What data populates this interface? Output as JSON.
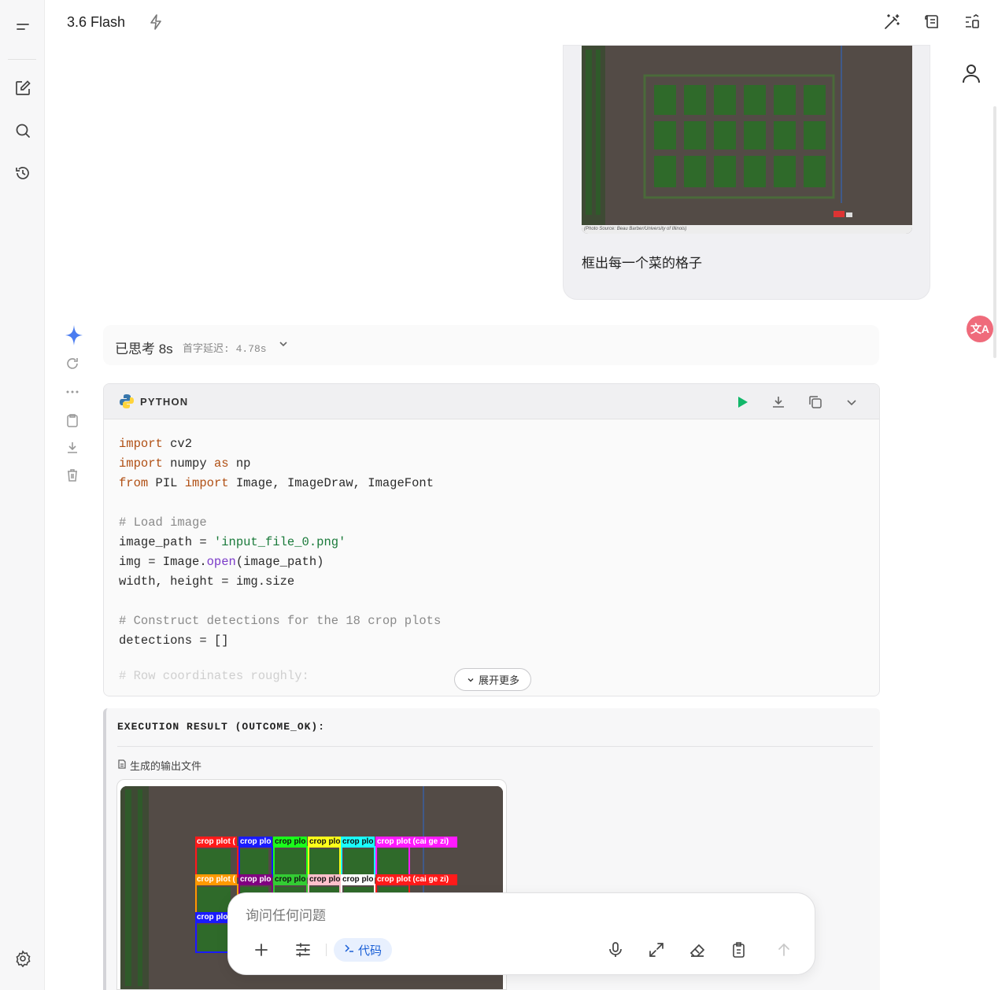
{
  "topbar": {
    "model": "3.6 Flash"
  },
  "user_message": {
    "photo_caption": "(Photo Source: Beau Barber/University of Illinois)",
    "text": "框出每一个菜的格子"
  },
  "thinking": {
    "label": "已思考 8s",
    "latency": "首字延迟: 4.78s"
  },
  "code_block": {
    "language": "PYTHON",
    "expand_label": "展开更多",
    "faded_line": "# Row coordinates roughly:"
  },
  "execution": {
    "title": "EXECUTION RESULT (OUTCOME_OK):",
    "files_label": "生成的输出文件",
    "boxes_row1": [
      {
        "label": "crop plot (",
        "color": "#ff1a1a"
      },
      {
        "label": "crop plo",
        "color": "#1a1aff"
      },
      {
        "label": "crop plo",
        "color": "#1aff1a"
      },
      {
        "label": "crop plo",
        "color": "#ffff1a"
      },
      {
        "label": "crop plo",
        "color": "#1affff"
      },
      {
        "label": "crop plot (cai ge zi)",
        "color": "#ff1aff"
      }
    ],
    "boxes_row2": [
      {
        "label": "crop plot (",
        "color": "#ff9900"
      },
      {
        "label": "crop plo",
        "color": "#800080"
      },
      {
        "label": "crop plo",
        "color": "#33cc33"
      },
      {
        "label": "crop plo",
        "color": "#ffc0cb"
      },
      {
        "label": "crop plo",
        "color": "#ffffff"
      },
      {
        "label": "crop plot (cai ge zi)",
        "color": "#ff1a1a"
      }
    ],
    "boxes_row3": [
      {
        "label": "crop plo",
        "color": "#1a1aff"
      }
    ]
  },
  "input": {
    "placeholder": "询问任何问题",
    "code_chip": "代码"
  },
  "translate_badge": "文A"
}
